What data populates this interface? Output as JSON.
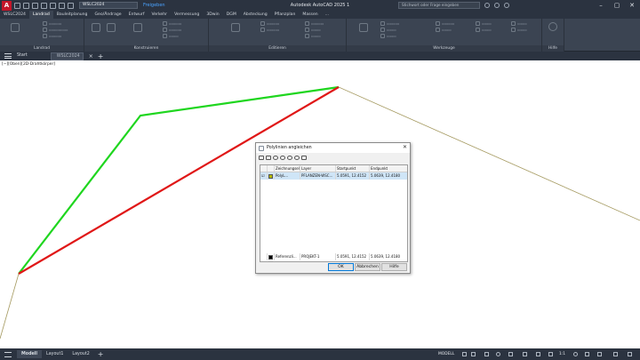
{
  "titlebar": {
    "logo": "A",
    "workspace": "WSLC2024",
    "share": "Freigeben",
    "title": "Autodesk AutoCAD 2025   1",
    "search_placeholder": "Stichwort oder Frage eingeben"
  },
  "ribbon": {
    "tabs": [
      "WSLC2024",
      "Landrad",
      "Bauleitplanung",
      "Geo/Ändrage",
      "Entwurf",
      "Verkehr",
      "Vermessung",
      "3Dwin",
      "DGM",
      "Absteckung",
      "Pflanzplan",
      "Massen",
      "..."
    ],
    "active_tab": "Landrad",
    "panels": [
      "Landrad",
      "Konstruieren",
      "Editieren",
      "Werkzeuge",
      "Hilfe"
    ]
  },
  "doc_tabs": {
    "start": "Start",
    "active": "WSLC2024"
  },
  "viewport": {
    "label": "[−][Oben][2D-Drahtkörper]"
  },
  "dialog": {
    "title": "Polylinien angleichen",
    "columns": [
      "Zeichnungselem...",
      "Layer",
      "Startpunkt",
      "Endpunkt"
    ],
    "rows": [
      {
        "check": "☑",
        "element": "PolyL...",
        "layer": "PFLANZEN-WSC...",
        "start": "5.0591, 12.4152",
        "end": "5.0639, 12.4180",
        "swatch_color": "#b5b900"
      }
    ],
    "reference": {
      "element": "Referenzli...",
      "layer": "PROJEKT-1",
      "start": "5.0591, 12.4152",
      "end": "5.0639, 12.4180",
      "swatch_color": "#000000"
    },
    "buttons": {
      "ok": "OK",
      "cancel": "Abbrechen",
      "help": "Hilfe"
    }
  },
  "statusbar": {
    "layouts": [
      "Modell",
      "Layout1",
      "Layout2"
    ],
    "active_layout": "Modell",
    "mode": "MODELL",
    "scale": "1:1"
  },
  "colors": {
    "green_polyline": "#1fd61f",
    "red_polyline": "#e01717",
    "olive_polyline": "#a4995f",
    "ui_dark": "#2b3340"
  }
}
